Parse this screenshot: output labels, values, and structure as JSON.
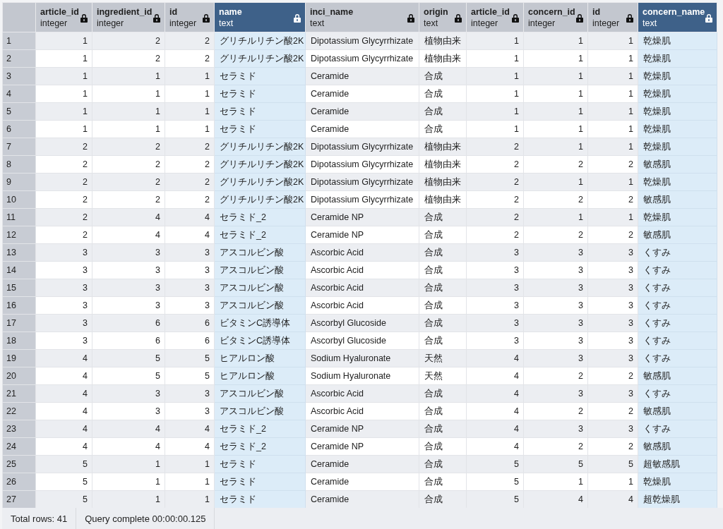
{
  "table": {
    "columns": [
      {
        "name": "article_id",
        "type": "integer",
        "selected": false
      },
      {
        "name": "ingredient_id",
        "type": "integer",
        "selected": false
      },
      {
        "name": "id",
        "type": "integer",
        "selected": false
      },
      {
        "name": "name",
        "type": "text",
        "selected": true
      },
      {
        "name": "inci_name",
        "type": "text",
        "selected": false
      },
      {
        "name": "origin",
        "type": "text",
        "selected": false
      },
      {
        "name": "article_id",
        "type": "integer",
        "selected": false
      },
      {
        "name": "concern_id",
        "type": "integer",
        "selected": false
      },
      {
        "name": "id",
        "type": "integer",
        "selected": false
      },
      {
        "name": "concern_name",
        "type": "text",
        "selected": true
      }
    ],
    "rows": [
      {
        "number": "1",
        "cells": [
          "1",
          "2",
          "2",
          "グリチルリチン酸2K",
          "Dipotassium Glycyrrhizate",
          "植物由来",
          "1",
          "1",
          "1",
          "乾燥肌"
        ]
      },
      {
        "number": "2",
        "cells": [
          "1",
          "2",
          "2",
          "グリチルリチン酸2K",
          "Dipotassium Glycyrrhizate",
          "植物由来",
          "1",
          "1",
          "1",
          "乾燥肌"
        ]
      },
      {
        "number": "3",
        "cells": [
          "1",
          "1",
          "1",
          "セラミド",
          "Ceramide",
          "合成",
          "1",
          "1",
          "1",
          "乾燥肌"
        ]
      },
      {
        "number": "4",
        "cells": [
          "1",
          "1",
          "1",
          "セラミド",
          "Ceramide",
          "合成",
          "1",
          "1",
          "1",
          "乾燥肌"
        ]
      },
      {
        "number": "5",
        "cells": [
          "1",
          "1",
          "1",
          "セラミド",
          "Ceramide",
          "合成",
          "1",
          "1",
          "1",
          "乾燥肌"
        ]
      },
      {
        "number": "6",
        "cells": [
          "1",
          "1",
          "1",
          "セラミド",
          "Ceramide",
          "合成",
          "1",
          "1",
          "1",
          "乾燥肌"
        ]
      },
      {
        "number": "7",
        "cells": [
          "2",
          "2",
          "2",
          "グリチルリチン酸2K",
          "Dipotassium Glycyrrhizate",
          "植物由来",
          "2",
          "1",
          "1",
          "乾燥肌"
        ]
      },
      {
        "number": "8",
        "cells": [
          "2",
          "2",
          "2",
          "グリチルリチン酸2K",
          "Dipotassium Glycyrrhizate",
          "植物由来",
          "2",
          "2",
          "2",
          "敏感肌"
        ]
      },
      {
        "number": "9",
        "cells": [
          "2",
          "2",
          "2",
          "グリチルリチン酸2K",
          "Dipotassium Glycyrrhizate",
          "植物由来",
          "2",
          "1",
          "1",
          "乾燥肌"
        ]
      },
      {
        "number": "10",
        "cells": [
          "2",
          "2",
          "2",
          "グリチルリチン酸2K",
          "Dipotassium Glycyrrhizate",
          "植物由来",
          "2",
          "2",
          "2",
          "敏感肌"
        ]
      },
      {
        "number": "11",
        "cells": [
          "2",
          "4",
          "4",
          "セラミド_2",
          "Ceramide NP",
          "合成",
          "2",
          "1",
          "1",
          "乾燥肌"
        ]
      },
      {
        "number": "12",
        "cells": [
          "2",
          "4",
          "4",
          "セラミド_2",
          "Ceramide NP",
          "合成",
          "2",
          "2",
          "2",
          "敏感肌"
        ]
      },
      {
        "number": "13",
        "cells": [
          "3",
          "3",
          "3",
          "アスコルビン酸",
          "Ascorbic Acid",
          "合成",
          "3",
          "3",
          "3",
          "くすみ"
        ]
      },
      {
        "number": "14",
        "cells": [
          "3",
          "3",
          "3",
          "アスコルビン酸",
          "Ascorbic Acid",
          "合成",
          "3",
          "3",
          "3",
          "くすみ"
        ]
      },
      {
        "number": "15",
        "cells": [
          "3",
          "3",
          "3",
          "アスコルビン酸",
          "Ascorbic Acid",
          "合成",
          "3",
          "3",
          "3",
          "くすみ"
        ]
      },
      {
        "number": "16",
        "cells": [
          "3",
          "3",
          "3",
          "アスコルビン酸",
          "Ascorbic Acid",
          "合成",
          "3",
          "3",
          "3",
          "くすみ"
        ]
      },
      {
        "number": "17",
        "cells": [
          "3",
          "6",
          "6",
          "ビタミンC誘導体",
          "Ascorbyl Glucoside",
          "合成",
          "3",
          "3",
          "3",
          "くすみ"
        ]
      },
      {
        "number": "18",
        "cells": [
          "3",
          "6",
          "6",
          "ビタミンC誘導体",
          "Ascorbyl Glucoside",
          "合成",
          "3",
          "3",
          "3",
          "くすみ"
        ]
      },
      {
        "number": "19",
        "cells": [
          "4",
          "5",
          "5",
          "ヒアルロン酸",
          "Sodium Hyaluronate",
          "天然",
          "4",
          "3",
          "3",
          "くすみ"
        ]
      },
      {
        "number": "20",
        "cells": [
          "4",
          "5",
          "5",
          "ヒアルロン酸",
          "Sodium Hyaluronate",
          "天然",
          "4",
          "2",
          "2",
          "敏感肌"
        ]
      },
      {
        "number": "21",
        "cells": [
          "4",
          "3",
          "3",
          "アスコルビン酸",
          "Ascorbic Acid",
          "合成",
          "4",
          "3",
          "3",
          "くすみ"
        ]
      },
      {
        "number": "22",
        "cells": [
          "4",
          "3",
          "3",
          "アスコルビン酸",
          "Ascorbic Acid",
          "合成",
          "4",
          "2",
          "2",
          "敏感肌"
        ]
      },
      {
        "number": "23",
        "cells": [
          "4",
          "4",
          "4",
          "セラミド_2",
          "Ceramide NP",
          "合成",
          "4",
          "3",
          "3",
          "くすみ"
        ]
      },
      {
        "number": "24",
        "cells": [
          "4",
          "4",
          "4",
          "セラミド_2",
          "Ceramide NP",
          "合成",
          "4",
          "2",
          "2",
          "敏感肌"
        ]
      },
      {
        "number": "25",
        "cells": [
          "5",
          "1",
          "1",
          "セラミド",
          "Ceramide",
          "合成",
          "5",
          "5",
          "5",
          "超敏感肌"
        ]
      },
      {
        "number": "26",
        "cells": [
          "5",
          "1",
          "1",
          "セラミド",
          "Ceramide",
          "合成",
          "5",
          "1",
          "1",
          "乾燥肌"
        ]
      },
      {
        "number": "27",
        "cells": [
          "5",
          "1",
          "1",
          "セラミド",
          "Ceramide",
          "合成",
          "5",
          "4",
          "4",
          "超乾燥肌"
        ]
      }
    ]
  },
  "status_bar": {
    "total_rows": "Total rows: 41",
    "query_status": "Query complete 00:00:00.125"
  }
}
